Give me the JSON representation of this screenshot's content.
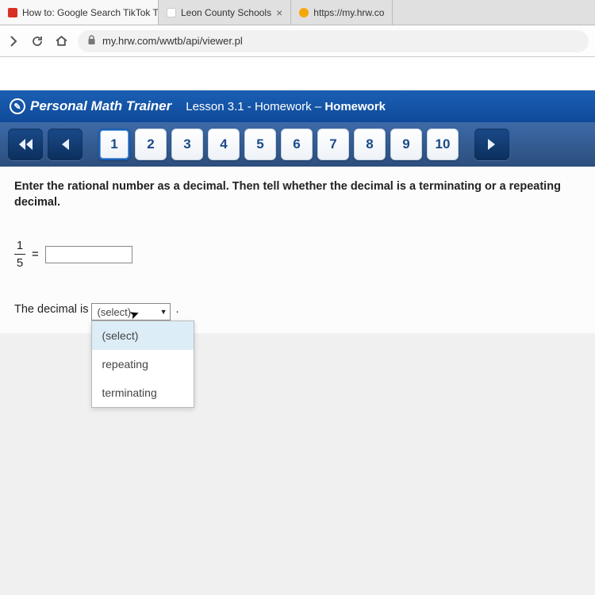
{
  "tabs": [
    {
      "label": "How to: Google Search TikTok T",
      "favicon": "#d93025",
      "closable": true
    },
    {
      "label": "Leon County Schools",
      "favicon": "#ffffff",
      "closable": true
    },
    {
      "label": "https://my.hrw.co",
      "favicon": "#f6a609",
      "closable": false
    }
  ],
  "addressBar": {
    "url": "my.hrw.com/wwtb/api/viewer.pl"
  },
  "header": {
    "brand": "Personal Math Trainer",
    "lesson_prefix": "Lesson 3.1 - Homework – ",
    "lesson_bold": "Homework"
  },
  "questionNav": {
    "numbers": [
      "1",
      "2",
      "3",
      "4",
      "5",
      "6",
      "7",
      "8",
      "9",
      "10"
    ],
    "active": "1"
  },
  "problem": {
    "instructions": "Enter the rational number as a decimal. Then tell whether the decimal is a terminating or a repeating decimal.",
    "fraction_num": "1",
    "fraction_den": "5",
    "equals": "=",
    "sentence_prefix": "The decimal is ",
    "select_placeholder": "(select)",
    "options": [
      "(select)",
      "repeating",
      "terminating"
    ],
    "period": "."
  }
}
